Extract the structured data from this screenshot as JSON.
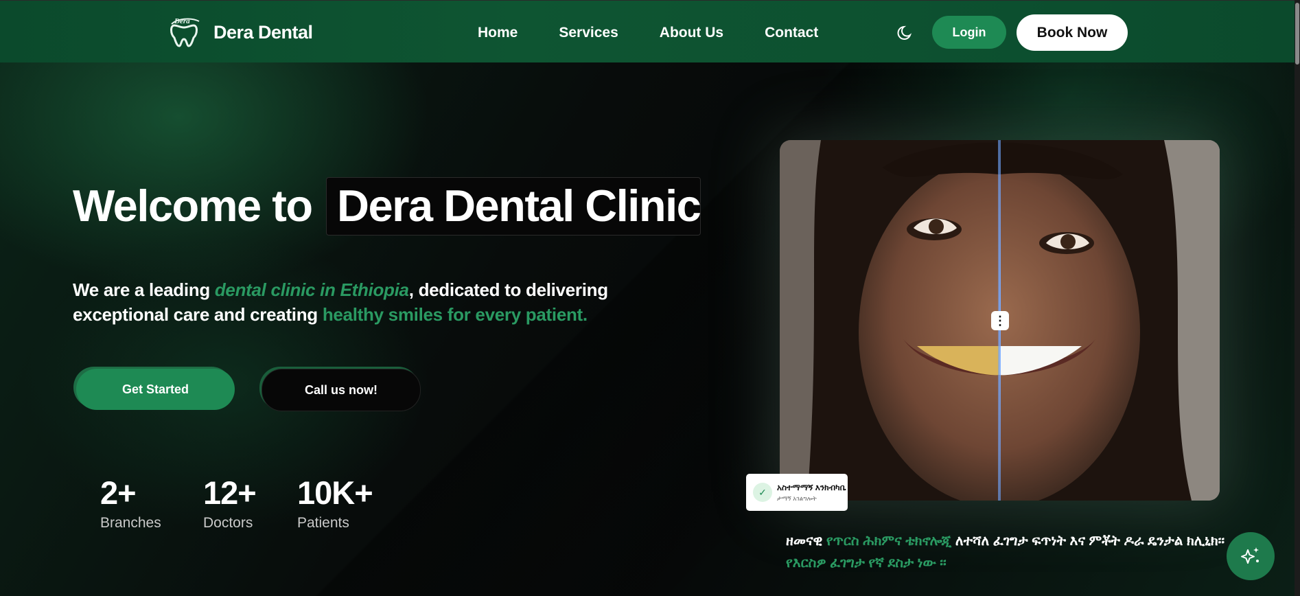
{
  "nav": {
    "brand": "Dera Dental",
    "logo_text": "Dera",
    "links": [
      "Home",
      "Services",
      "About Us",
      "Contact"
    ],
    "login": "Login",
    "book": "Book Now"
  },
  "hero": {
    "title_prefix": "Welcome to",
    "title_highlight": "Dera Dental Clinic",
    "sub_1": "We are a leading ",
    "sub_italic": "dental clinic in Ethiopia",
    "sub_2": ", dedicated to delivering exceptional care and creating ",
    "sub_green": "healthy smiles for every patient.",
    "btn_start": "Get Started",
    "btn_call": "Call us now!",
    "stats": [
      {
        "num": "2+",
        "label": "Branches"
      },
      {
        "num": "12+",
        "label": "Doctors"
      },
      {
        "num": "10K+",
        "label": "Patients"
      }
    ]
  },
  "image_card": {
    "badge_title": "አስተማማኝ እንክብካቤ",
    "badge_sub": "ታማኝ አገልግሎት",
    "am_1": "ዘመናዊ ",
    "am_green_1": "የጥርስ ሕክምና ቴክኖሎጂ",
    "am_2": " ለተሻለ ፈገግታ  ፍጥነት እና ምቾት ዶራ ዴንታል ክሊኒክ፡፡",
    "am_green_2": "   የእርስዎ ፈገግታ የኛ ደስታ ነው ፡፡"
  },
  "icons": {
    "logo": "tooth-logo-icon",
    "theme": "moon-icon",
    "fab": "sparkles-icon",
    "badge": "check-icon"
  },
  "colors": {
    "accent": "#1e8a54",
    "accent_text": "#2a9a62",
    "nav_bg": "#0d5130"
  }
}
